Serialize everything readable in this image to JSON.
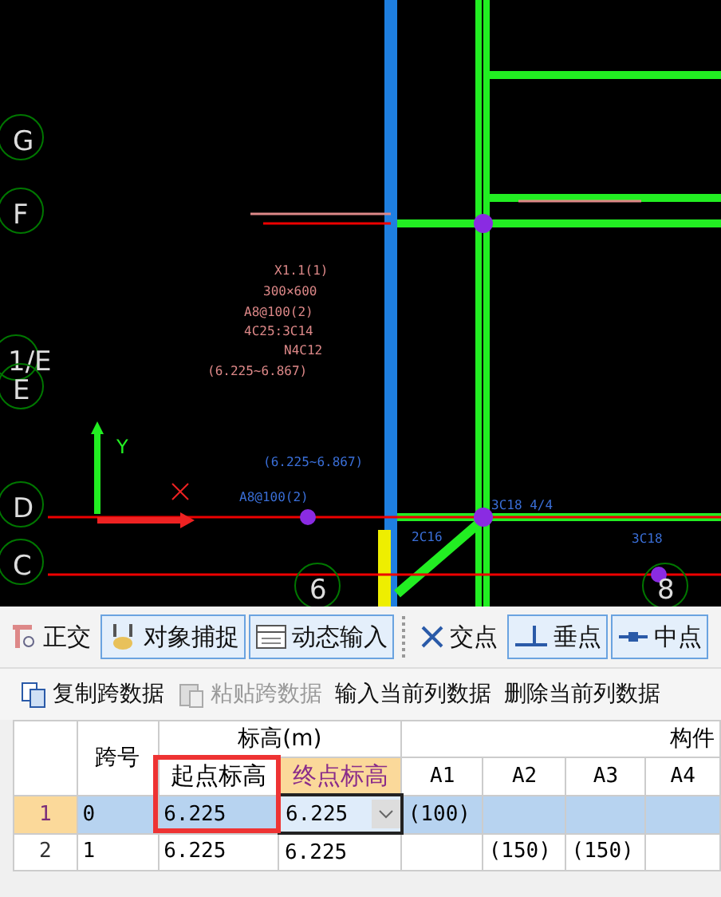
{
  "canvas": {
    "axis_labels": [
      "G",
      "F",
      "1/E",
      "E",
      "D",
      "C",
      "6",
      "8"
    ],
    "annotations": [
      "X1.1(1)",
      "300×600",
      "A8@100(2)",
      "4C25:3C14",
      "N4C12",
      "(6.225~6.867)",
      "(6.225~6.867)",
      "A8@100(2)",
      "2C16",
      "3C18",
      "3C18 4/4"
    ],
    "ucs_label": "Y"
  },
  "snap_toolbar": [
    {
      "label": "正交",
      "selected": false
    },
    {
      "label": "对象捕捉",
      "selected": true
    },
    {
      "label": "动态输入",
      "selected": true
    },
    {
      "label": "交点",
      "selected": false
    },
    {
      "label": "垂点",
      "selected": true
    },
    {
      "label": "中点",
      "selected": true
    }
  ],
  "table_toolbar": [
    {
      "label": "复制跨数据",
      "disabled": false
    },
    {
      "label": "粘贴跨数据",
      "disabled": true
    },
    {
      "label": "输入当前列数据",
      "disabled": false
    },
    {
      "label": "删除当前列数据",
      "disabled": false
    }
  ],
  "table": {
    "span_header": "跨号",
    "elevation_header": "标高(m)",
    "component_header": "构件",
    "columns": [
      {
        "label": "起点标高",
        "selected": false,
        "highlighted": true
      },
      {
        "label": "终点标高",
        "selected": true,
        "highlighted": false
      },
      {
        "label": "A1",
        "selected": false,
        "highlighted": false
      },
      {
        "label": "A2",
        "selected": false,
        "highlighted": false
      },
      {
        "label": "A3",
        "selected": false,
        "highlighted": false
      },
      {
        "label": "A4",
        "selected": false,
        "highlighted": false
      }
    ],
    "rows": [
      {
        "number": "1",
        "span": "0",
        "cells": [
          "6.225",
          "6.225",
          "(100)",
          "",
          "",
          ""
        ],
        "selected": true
      },
      {
        "number": "2",
        "span": "1",
        "cells": [
          "6.225",
          "6.225",
          "",
          "(150)",
          "(150)",
          ""
        ],
        "selected": false
      }
    ]
  }
}
